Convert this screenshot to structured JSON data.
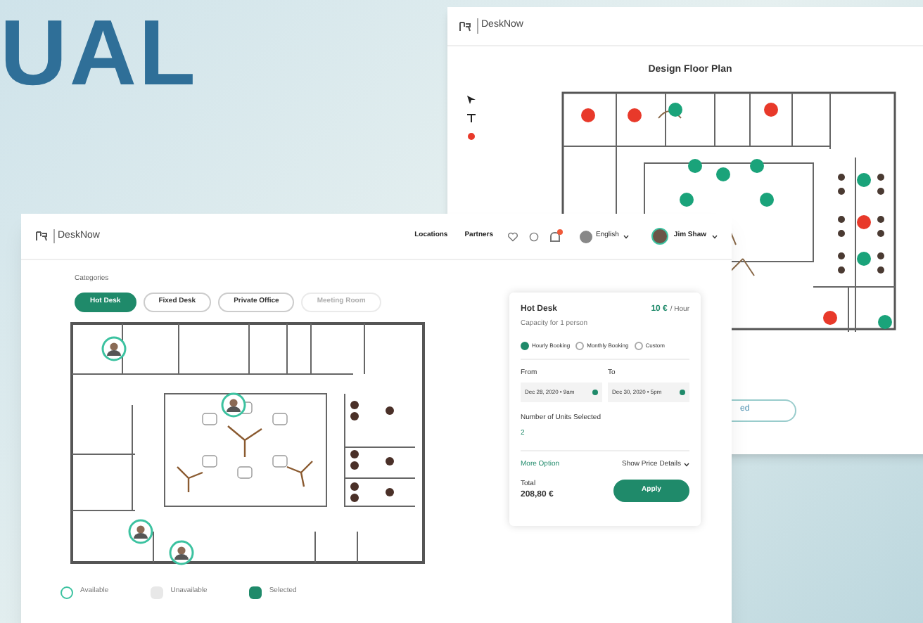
{
  "headline": "UAL",
  "back_window": {
    "logo": "DeskNow",
    "title": "Design Floor Plan",
    "button": "ed"
  },
  "front_window": {
    "logo": "DeskNow",
    "nav": [
      "Locations",
      "Partners"
    ],
    "language": "English",
    "user": "Jim Shaw",
    "notification_badge": true,
    "categories_label": "Categories",
    "categories": [
      {
        "label": "Hot Desk",
        "selected": true,
        "disabled": false
      },
      {
        "label": "Fixed Desk",
        "selected": false,
        "disabled": false
      },
      {
        "label": "Private Office",
        "selected": false,
        "disabled": false
      },
      {
        "label": "Meeting Room",
        "selected": false,
        "disabled": true
      }
    ],
    "legend": [
      {
        "label": "Available",
        "kind": "available"
      },
      {
        "label": "Unavailable",
        "kind": "unavailable"
      },
      {
        "label": "Selected",
        "kind": "selected"
      }
    ],
    "booking": {
      "title": "Hot Desk",
      "price": "10 €",
      "unit": "/ Hour",
      "capacity": "Capacity for 1 person",
      "options": [
        {
          "label": "Hourly Booking",
          "selected": true
        },
        {
          "label": "Monthly Booking",
          "selected": false
        },
        {
          "label": "Custom",
          "selected": false
        }
      ],
      "from_label": "From",
      "from_value": "Dec 28, 2020 • 9am",
      "to_label": "To",
      "to_value": "Dec 30, 2020 • 5pm",
      "units_label": "Number of Units Selected",
      "units_value": "2",
      "more_option": "More Option",
      "price_details": "Show Price Details",
      "total_label": "Total",
      "total_value": "208,80 €",
      "apply": "Apply"
    }
  }
}
